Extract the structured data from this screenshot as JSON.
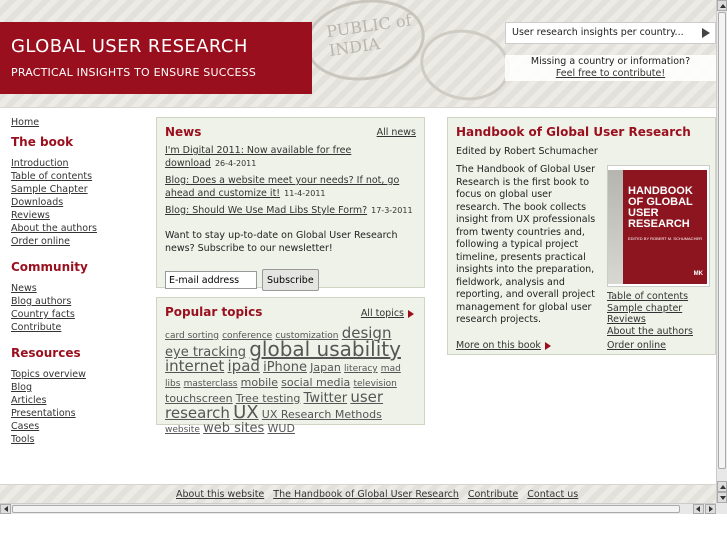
{
  "header": {
    "title": "GLOBAL USER RESEARCH",
    "tagline": "PRACTICAL INSIGHTS TO ENSURE SUCCESS",
    "stamp_text": "PUBLIC of INDIA",
    "country_select": "User research insights per country...",
    "missing_text": "Missing a country or information?",
    "contribute_link": "Feel free to contribute!"
  },
  "nav": {
    "home": "Home",
    "sections": [
      {
        "title": "The book",
        "items": [
          "Introduction",
          "Table of contents",
          "Sample Chapter",
          "Downloads",
          "Reviews",
          "About the authors",
          "Order online"
        ]
      },
      {
        "title": "Community",
        "items": [
          "News",
          "Blog authors",
          "Country facts",
          "Contribute"
        ]
      },
      {
        "title": "Resources",
        "items": [
          "Topics overview",
          "Blog",
          "Articles",
          "Presentations",
          "Cases",
          "Tools"
        ]
      }
    ]
  },
  "news": {
    "title": "News",
    "all_link": "All news",
    "items": [
      {
        "text": "I'm Digital 2011: Now available for free download",
        "date": "26-4-2011"
      },
      {
        "text": "Blog: Does a website meet your needs? If not, go ahead and customize it!",
        "date": "11-4-2011"
      },
      {
        "text": "Blog: Should We Use Mad Libs Style Form?",
        "date": "17-3-2011"
      }
    ],
    "subscribe_text": "Want to stay up-to-date on Global User Research news? Subscribe to our newsletter!",
    "email_value": "E-mail address",
    "subscribe_button": "Subscribe"
  },
  "topics": {
    "title": "Popular topics",
    "all_link": "All topics",
    "tags": [
      {
        "t": "card sorting",
        "s": 1
      },
      {
        "t": "conference",
        "s": 1
      },
      {
        "t": "customization",
        "s": 1
      },
      {
        "t": "design",
        "s": 4
      },
      {
        "t": "eye tracking",
        "s": 3
      },
      {
        "t": "global usability",
        "s": 6
      },
      {
        "t": "internet",
        "s": 4
      },
      {
        "t": "ipad",
        "s": 4
      },
      {
        "t": "iPhone",
        "s": 3
      },
      {
        "t": "Japan",
        "s": 2
      },
      {
        "t": "literacy",
        "s": 1
      },
      {
        "t": "mad libs",
        "s": 1
      },
      {
        "t": "masterclass",
        "s": 1
      },
      {
        "t": "mobile",
        "s": 2
      },
      {
        "t": "social media",
        "s": 2
      },
      {
        "t": "television",
        "s": 1
      },
      {
        "t": "touchscreen",
        "s": 2
      },
      {
        "t": "Tree testing",
        "s": 2
      },
      {
        "t": "Twitter",
        "s": 3
      },
      {
        "t": "user research",
        "s": 4
      },
      {
        "t": "UX",
        "s": 5
      },
      {
        "t": "UX Research Methods",
        "s": 2
      },
      {
        "t": "website",
        "s": 1
      },
      {
        "t": "web sites",
        "s": 3
      },
      {
        "t": "WUD",
        "s": 2
      }
    ]
  },
  "book": {
    "title": "Handbook of Global User Research",
    "editor": "Edited by Robert Schumacher",
    "description": "The Handbook of Global User Research is the first book to focus on global user research. The book collects insight from UX professionals from twenty countries and, following a typical project timeline, presents practical insights into the preparation, fieldwork, analysis and reporting, and overall project management for global user research projects.",
    "cover_title": "HANDBOOK OF GLOBAL USER RESEARCH",
    "cover_editor": "EDITED BY ROBERT M. SCHUMACHER",
    "cover_publisher": "MK",
    "links": [
      "Table of contents",
      "Sample chapter",
      "Reviews",
      "About the authors"
    ],
    "more_link": "More on this book",
    "order_link": "Order online"
  },
  "footer": {
    "links": [
      "About this website",
      "The Handbook of Global User Research",
      "Contribute",
      "Contact us"
    ]
  }
}
